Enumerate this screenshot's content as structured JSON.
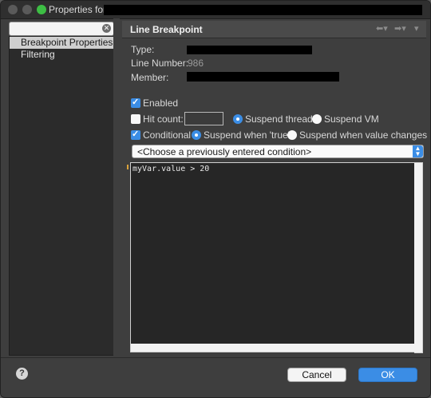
{
  "window": {
    "title": "Properties for"
  },
  "sidebar": {
    "items": [
      {
        "label": "Breakpoint Properties",
        "selected": true
      },
      {
        "label": "Filtering",
        "selected": false
      }
    ]
  },
  "header": {
    "title": "Line Breakpoint"
  },
  "info": {
    "type_label": "Type:",
    "line_number_label": "Line Number:",
    "line_number_value": "986",
    "member_label": "Member:"
  },
  "options": {
    "enabled_label": "Enabled",
    "enabled_checked": true,
    "hit_count_label": "Hit count:",
    "hit_count_checked": false,
    "hit_count_value": "",
    "suspend_thread_label": "Suspend thread",
    "suspend_vm_label": "Suspend VM",
    "suspend_selected": "Suspend thread",
    "conditional_label": "Conditional",
    "conditional_checked": true,
    "suspend_true_label": "Suspend when 'true'",
    "suspend_changes_label": "Suspend when value changes",
    "condition_mode_selected": "Suspend when 'true'"
  },
  "condition": {
    "combo_text": "<Choose a previously entered condition>",
    "editor_text": "myVar.value > 20"
  },
  "footer": {
    "help_label": "?",
    "cancel_label": "Cancel",
    "ok_label": "OK"
  },
  "colors": {
    "accent": "#3b8de5",
    "background": "#3e3e3e",
    "editor_background": "#262626"
  }
}
